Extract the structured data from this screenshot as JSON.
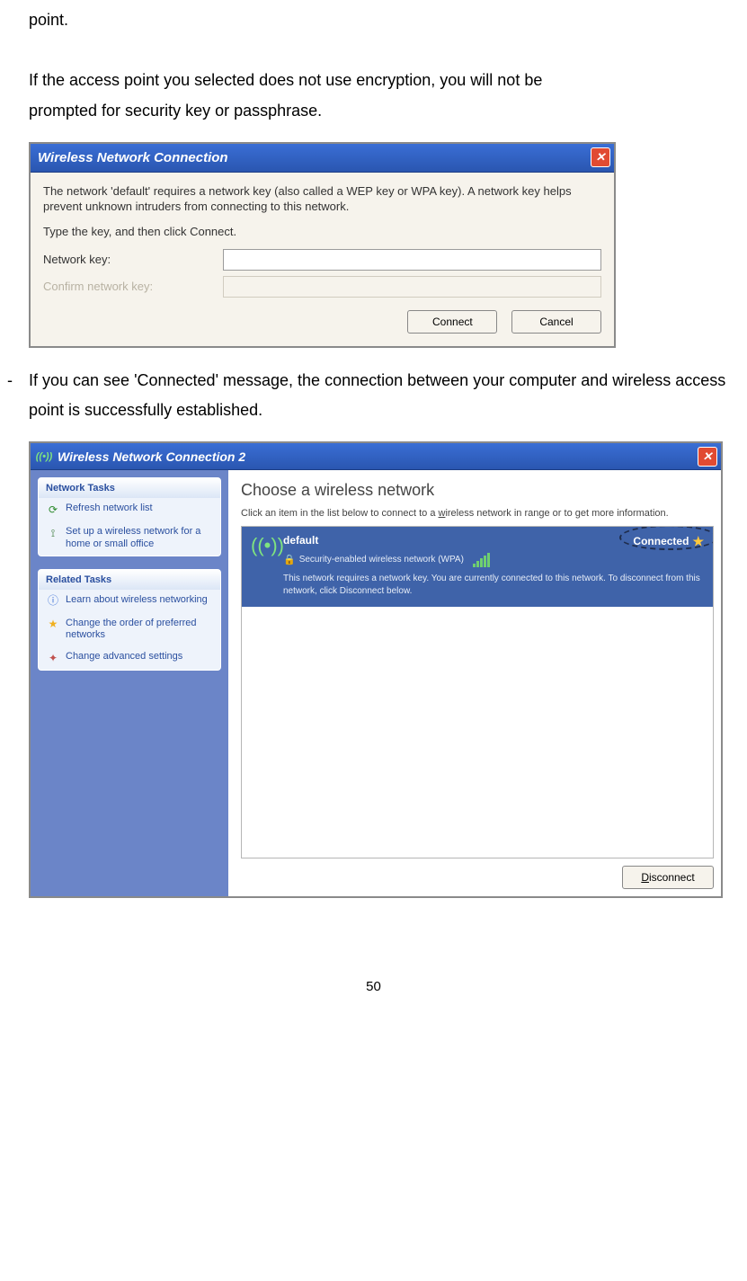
{
  "doc": {
    "line_point": "point.",
    "para1a": "If the access point you selected does not use encryption, you will not be",
    "para1b": "prompted for security key or passphrase.",
    "bullet2": "If you can see 'Connected' message, the connection between your computer and wireless access point is successfully established.",
    "page_number": "50"
  },
  "dialog1": {
    "title": "Wireless Network Connection",
    "text1": "The network 'default' requires a network key (also called a WEP key or WPA key). A network key helps prevent unknown intruders from connecting to this network.",
    "text2": "Type the key, and then click Connect.",
    "label_key": "Network key:",
    "label_confirm": "Confirm network key:",
    "btn_connect": "Connect",
    "btn_cancel": "Cancel"
  },
  "dialog2": {
    "title": "Wireless Network Connection 2",
    "sidebar": {
      "panel1_title": "Network Tasks",
      "panel1_items": [
        "Refresh network list",
        "Set up a wireless network for a home or small office"
      ],
      "panel2_title": "Related Tasks",
      "panel2_items": [
        "Learn about wireless networking",
        "Change the order of preferred networks",
        "Change advanced settings"
      ]
    },
    "main": {
      "heading": "Choose a wireless network",
      "sub_a": "Click an item in the list below to connect to a ",
      "sub_u": "w",
      "sub_b": "ireless network in range or to get more information.",
      "network_name": "default",
      "status": "Connected",
      "security": "Security-enabled wireless network (WPA)",
      "desc": "This network requires a network key. You are currently connected to this network. To disconnect from this network, click Disconnect below.",
      "btn_disconnect": "Disconnect"
    }
  }
}
